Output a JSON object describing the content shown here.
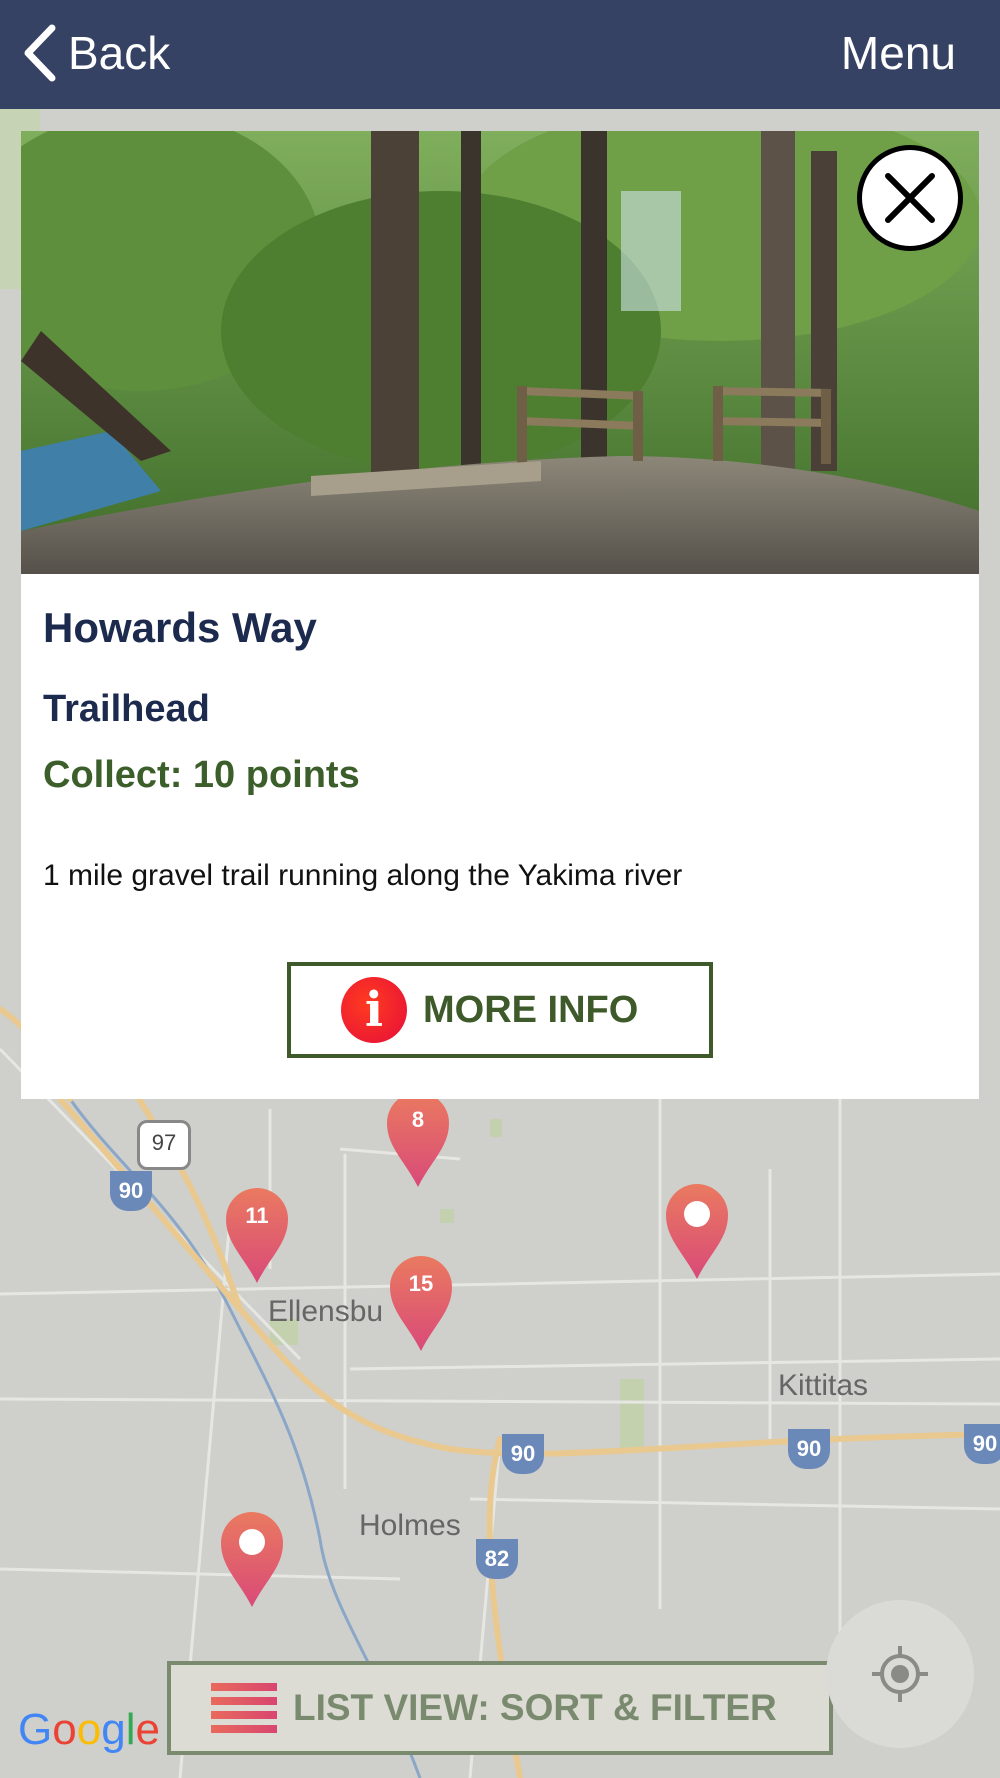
{
  "header": {
    "back_label": "Back",
    "menu_label": "Menu"
  },
  "card": {
    "title": "Howards Way",
    "category": "Trailhead",
    "points_text": "Collect: 10 points",
    "description": "1 mile gravel trail running along the Yakima river",
    "more_info_label": "MORE INFO",
    "info_icon_glyph": "i"
  },
  "map": {
    "labels": [
      "Ellensbu",
      "Kittitas",
      "Holmes"
    ],
    "shields": [
      "97",
      "90",
      "90",
      "90",
      "90",
      "82"
    ],
    "pins": [
      "8",
      "11",
      "15"
    ],
    "google_logo": "Google"
  },
  "bottom": {
    "list_button_label": "LIST VIEW: SORT & FILTER"
  },
  "colors": {
    "header_bg": "#364264",
    "title": "#1c2a4e",
    "accent_green": "#3c5e2a",
    "pin": "#e4606a"
  },
  "icons": {
    "back": "chevron-left-icon",
    "close": "close-icon",
    "info": "info-icon",
    "list": "list-icon",
    "locate": "crosshair-icon"
  }
}
